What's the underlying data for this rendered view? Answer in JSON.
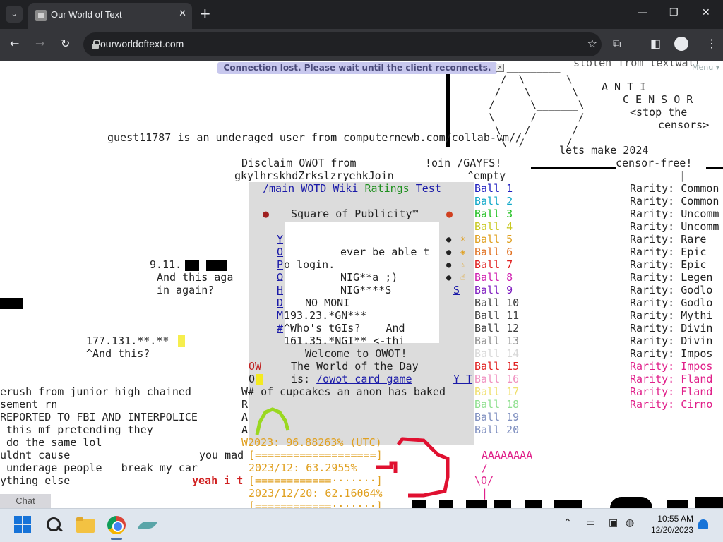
{
  "browser": {
    "tab_title": "Our World of Text",
    "tab_close": "✕",
    "new_tab": "+",
    "url": "ourworldoftext.com",
    "back": "←",
    "forward": "→",
    "reload": "↻",
    "bookmark": "☆",
    "minimize": "—",
    "maximize": "❐",
    "close": "✕",
    "tab_search": "⌄"
  },
  "page": {
    "banner": "Connection lost. Please wait until the client reconnects.",
    "banner_close": "x",
    "menu": "Menu ▾",
    "art_top": "    _________\n   /  \\       \\\n  /    \\       \\\n /      \\_______\\\n \\      /       /\n  \\    /       /\n   \\  /       /",
    "stolen": "stolen from textwall",
    "anti": "A N T I",
    "censor": "C E N S O R",
    "stop": "<stop the",
    "censors": "censors>",
    "guest": "guest11787 is an underaged user from computernewb.com/collab-vm//",
    "lets_make": "lets make 2024",
    "censor_free": "censor-free!",
    "pipe": "|",
    "disclaim": "Disclaim OWOT from",
    "join": "!oin /GAYFS!",
    "gibberish": "gkylhrskhdZrkslzryehkJoin",
    "empty": "^empty",
    "links": [
      "/main",
      "WOTD",
      "Wiki",
      "Ratings",
      "Test"
    ],
    "square_title": "Square of Publicity™",
    "square_left": [
      "Y",
      "O",
      "P",
      "Ω",
      "H",
      "D",
      "M",
      "#"
    ],
    "ever": "ever be able t",
    "login": "o login.",
    "nig1": "NIG**a ;)",
    "nig2": "NIG****S",
    "no_moni": "NO MONI",
    "ip1": "193.23.*GN***",
    "who": "^Who's tGIs?    And",
    "ip2": "161.35.*NGI** <-thi",
    "welcome": "Welcome to OWOT!",
    "wotd": "The World of the Day",
    "wotd_is": "is: ",
    "card_game": "/owot_card_game",
    "ow": "OW",
    "o": "O",
    "yt": "Y T",
    "s_link": "S",
    "date_911": "9.11.",
    "and_this": "And this aga",
    "in_again": "in again?",
    "ip3": "177.131.**.**",
    "and_this2": "^And this?",
    "wcupcakes": "W# of cupcakes an anon has baked",
    "left_lines": [
      "erush from junior high chained",
      "sement rn",
      "REPORTED TO FBI AND INTERPOLICE",
      " this mf pretending they",
      " do the same lol",
      "uldnt cause",
      " underage people   break my car",
      "ything else"
    ],
    "raaw": [
      "R",
      "A",
      "A",
      "W"
    ],
    "you_mad": "you mad",
    "yeah": "yeah i t",
    "prog_2023": "2023: 96.88263% (UTC)",
    "bar_full": "[===================]",
    "prog_month": "2023/12: 63.2955%",
    "bar_month": "[============·······]",
    "prog_day": "2023/12/20: 62.16064%",
    "bar_day": "[============·······]",
    "aaa": "AAAAAAAA",
    "stick1": "/",
    "stick2": "\\O/",
    "stick3": "|",
    "balls": [
      "Ball 1",
      "Ball 2",
      "Ball 3",
      "Ball 4",
      "Ball 5",
      "Ball 6",
      "Ball 7",
      "Ball 8",
      "Ball 9",
      "Ball 10",
      "Ball 11",
      "Ball 12",
      "Ball 13",
      "Ball 14",
      "Ball 15",
      "Ball 16",
      "Ball 17",
      "Ball 18",
      "Ball 19",
      "Ball 20"
    ],
    "ball_colors": [
      "#2020c0",
      "#10a8c8",
      "#20c020",
      "#c8c820",
      "#e0a020",
      "#e07020",
      "#e02020",
      "#d020b0",
      "#8020c0",
      "#404040",
      "#404040",
      "#404040",
      "#909090",
      "#d8d8d8",
      "#e02020",
      "#f090c0",
      "#f0e070",
      "#90e090",
      "#8090c0",
      "#8090c0"
    ],
    "rarities": [
      "Rarity: Common",
      "Rarity: Common",
      "Rarity: Uncomm",
      "Rarity: Uncomm",
      "Rarity: Rare",
      "Rarity: Epic",
      "Rarity: Epic",
      "Rarity: Legen",
      "Rarity: Godlo",
      "Rarity: Godlo",
      "Rarity: Mythi",
      "Rarity: Divin",
      "Rarity: Divin",
      "Rarity: Impos",
      "Rarity: Impos",
      "Rarity: Fland",
      "Rarity: Fland",
      "Rarity: Cirno"
    ],
    "rarity_colors": [
      "#222",
      "#222",
      "#222",
      "#222",
      "#222",
      "#222",
      "#222",
      "#222",
      "#222",
      "#222",
      "#222",
      "#222",
      "#222",
      "#222",
      "#e0208a",
      "#e0208a",
      "#e0208a",
      "#e0208a"
    ],
    "chat": "Chat"
  },
  "taskbar": {
    "time": "10:55 AM",
    "date": "12/20/2023",
    "chevron": "⌃"
  }
}
